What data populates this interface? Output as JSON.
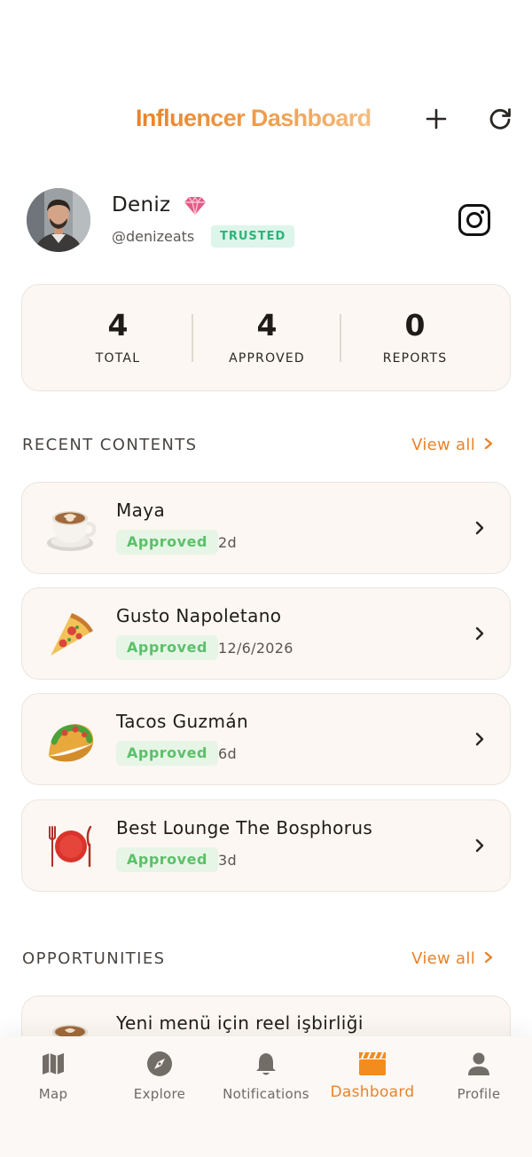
{
  "header": {
    "title": "Influencer Dashboard",
    "add_icon": "plus-icon",
    "refresh_icon": "refresh-icon"
  },
  "profile": {
    "name": "Deniz",
    "handle": "@denizeats",
    "badge": "TRUSTED",
    "tier_icon": "gem-icon",
    "social_icon": "instagram-icon"
  },
  "stats": [
    {
      "value": "4",
      "label": "TOTAL"
    },
    {
      "value": "4",
      "label": "APPROVED"
    },
    {
      "value": "0",
      "label": "REPORTS"
    }
  ],
  "recent": {
    "title": "RECENT CONTENTS",
    "view_all": "View all",
    "items": [
      {
        "name": "Maya",
        "status": "Approved",
        "meta": "2d",
        "icon": "coffee-icon"
      },
      {
        "name": "Gusto Napoletano",
        "status": "Approved",
        "meta": "12/6/2026",
        "icon": "pizza-icon"
      },
      {
        "name": "Tacos Guzmán",
        "status": "Approved",
        "meta": "6d",
        "icon": "taco-icon"
      },
      {
        "name": "Best Lounge The Bosphorus",
        "status": "Approved",
        "meta": "3d",
        "icon": "plate-icon"
      }
    ]
  },
  "opportunities": {
    "title": "OPPORTUNITIES",
    "view_all": "View all",
    "items": [
      {
        "name": "Yeni menü için reel işbirliği",
        "icon": "coffee-icon"
      }
    ]
  },
  "nav": [
    {
      "label": "Map",
      "icon": "map-icon",
      "active": false
    },
    {
      "label": "Explore",
      "icon": "compass-icon",
      "active": false
    },
    {
      "label": "Notifications",
      "icon": "bell-icon",
      "active": false
    },
    {
      "label": "Dashboard",
      "icon": "clapperboard-icon",
      "active": true
    },
    {
      "label": "Profile",
      "icon": "person-icon",
      "active": false
    }
  ],
  "colors": {
    "accent": "#e9832a",
    "approved_text": "#5cc06a",
    "trusted_text": "#2bb47a",
    "card_bg": "#fcf7f2"
  }
}
